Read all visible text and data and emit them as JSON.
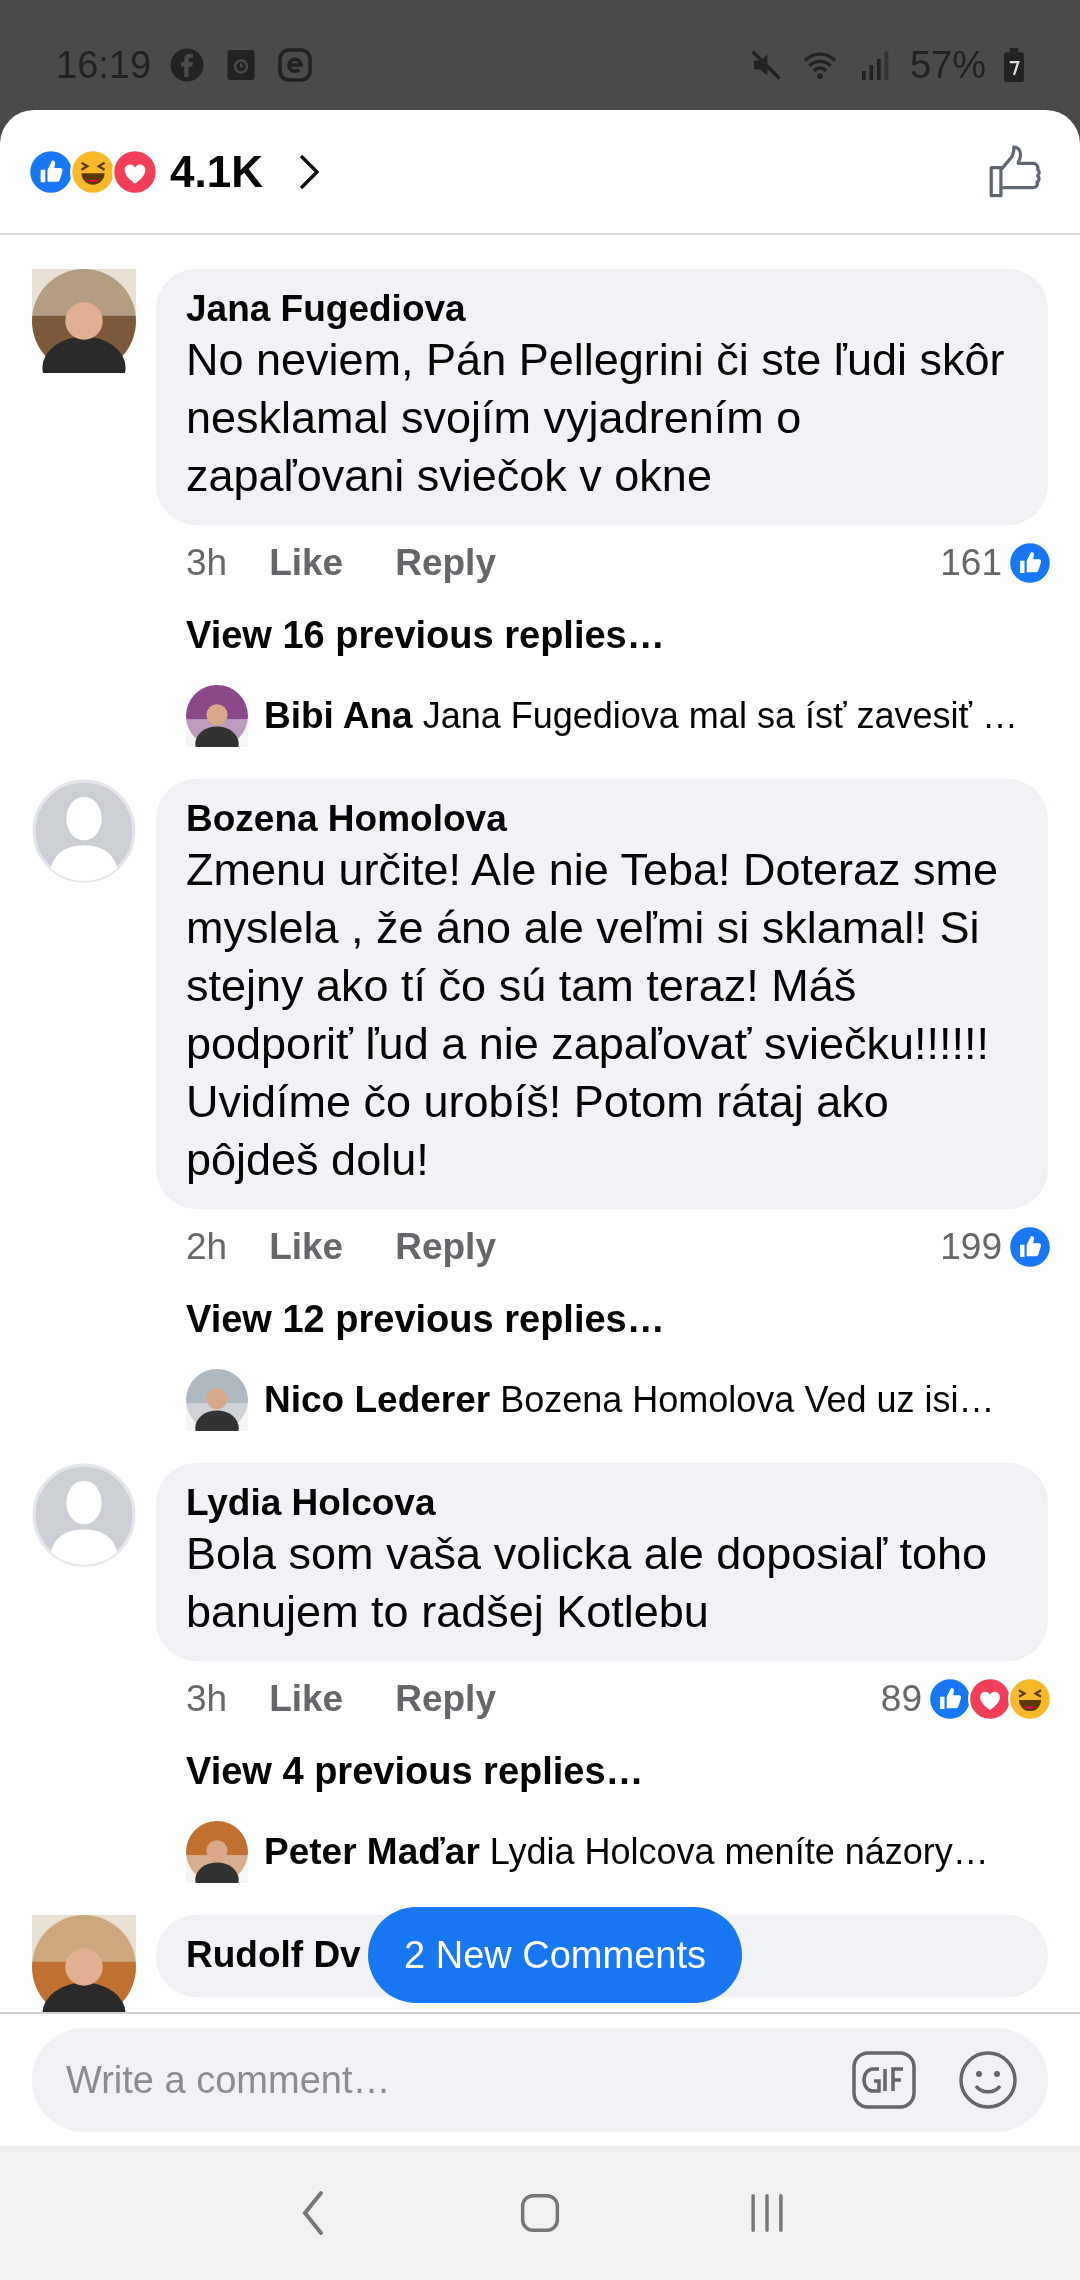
{
  "status_bar": {
    "time": "16:19",
    "battery": "57%"
  },
  "header": {
    "reactions": [
      {
        "kind": "like"
      },
      {
        "kind": "haha"
      },
      {
        "kind": "love"
      }
    ],
    "count": "4.1K"
  },
  "comments": [
    {
      "name": "Jana Fugediova",
      "text": "No neviem, Pán Pellegrini či ste ľudi skôr nesklamal svojím vyjadrením o zapaľovani sviečok v okne",
      "time": "3h",
      "like": "Like",
      "reply": "Reply",
      "reaction_count": "161",
      "reactions": [
        {
          "kind": "like"
        }
      ],
      "view_replies": "View 16 previous replies…",
      "last_reply": {
        "name": "Bibi Ana",
        "text": "Jana Fugediova mal sa ísť zavesiť …"
      }
    },
    {
      "avatar": {
        "kind": "default"
      },
      "name": "Bozena Homolova",
      "text": "Zmenu určite! Ale nie Teba! Doteraz sme myslela , že áno ale veľmi si sklamal! Si stejny ako  tí čo sú tam teraz! Máš podporiť ľud a nie zapaľovať sviečku!!!!!! Uvidíme čo urobíš! Potom rátaj ako pôjdeš dolu!",
      "time": "2h",
      "like": "Like",
      "reply": "Reply",
      "reaction_count": "199",
      "reactions": [
        {
          "kind": "like"
        }
      ],
      "view_replies": "View 12 previous replies…",
      "last_reply": {
        "name": "Nico Lederer",
        "text": "Bozena Homolova Ved uz isi…"
      }
    },
    {
      "avatar": {
        "kind": "default"
      },
      "name": "Lydia Holcova",
      "text": "Bola som vaša volicka ale doposiaľ toho banujem  to radšej Kotlebu",
      "time": "3h",
      "like": "Like",
      "reply": "Reply",
      "reaction_count": "89",
      "reactions": [
        {
          "kind": "like"
        },
        {
          "kind": "love"
        },
        {
          "kind": "haha"
        }
      ],
      "view_replies": "View 4 previous replies…",
      "last_reply": {
        "name": "Peter Maďar",
        "text": "Lydia Holcova  meníte názory…"
      }
    },
    {
      "name": "Rudolf Dv"
    }
  ],
  "new_comments": "2 New Comments",
  "composer": {
    "placeholder": "Write a comment…"
  }
}
